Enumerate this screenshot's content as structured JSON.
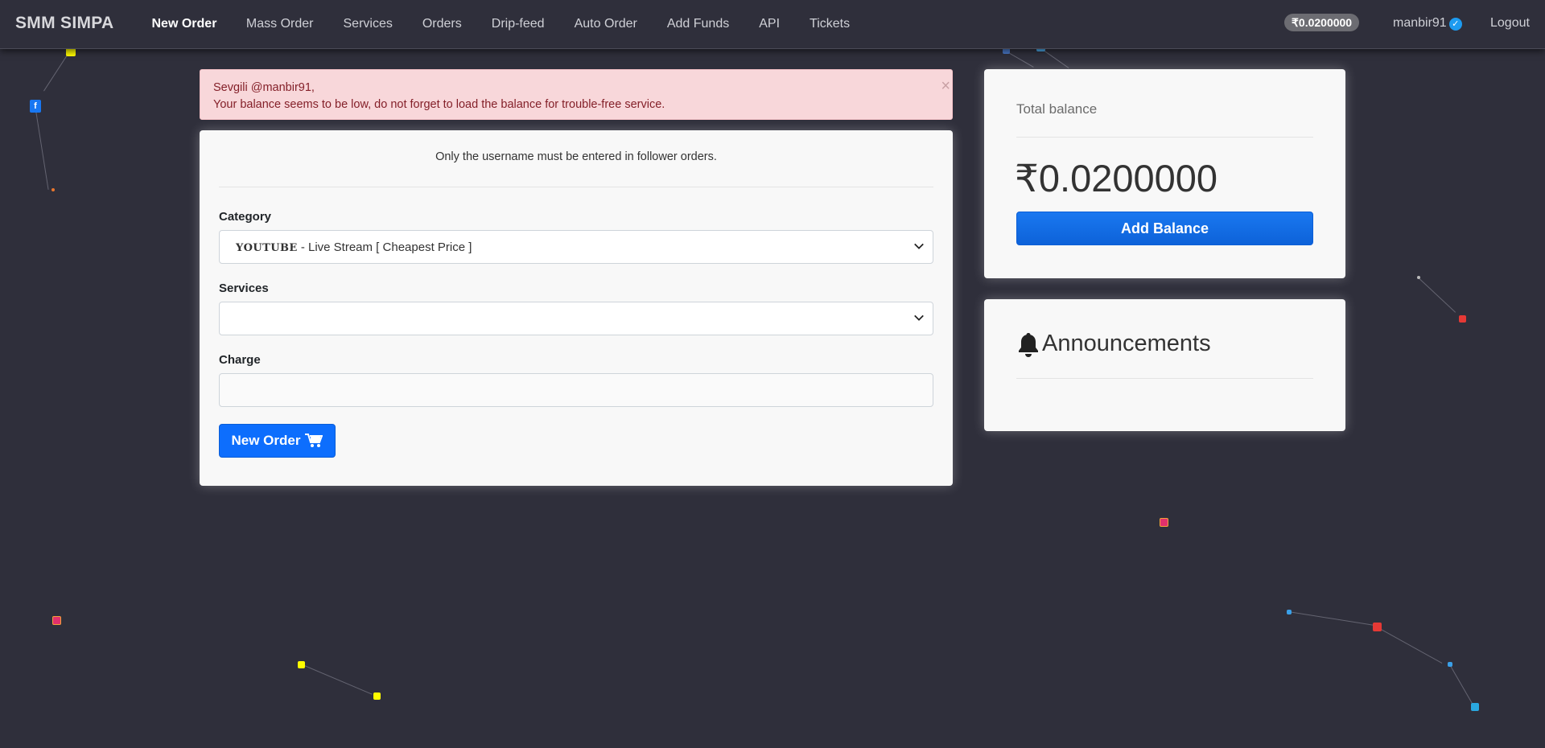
{
  "nav": {
    "brand": "SMM SIMPA",
    "links": [
      {
        "label": "New Order"
      },
      {
        "label": "Mass Order"
      },
      {
        "label": "Services"
      },
      {
        "label": "Orders"
      },
      {
        "label": "Drip-feed"
      },
      {
        "label": "Auto Order"
      },
      {
        "label": "Add Funds"
      },
      {
        "label": "API"
      },
      {
        "label": "Tickets"
      }
    ],
    "balance": "₹0.0200000",
    "username": "manbir91",
    "verified_icon": "check-icon",
    "logout": "Logout"
  },
  "alert": {
    "greeting": "Sevgili @manbir91,",
    "message": "Your balance seems to be low, do not forget to load the balance for trouble-free service.",
    "close": "×"
  },
  "order_form": {
    "notice": "Only the username must be entered in follower orders.",
    "category_label": "Category",
    "category_platform": "YOUTUBE",
    "category_value": " - Live Stream [ Cheapest Price ]",
    "services_label": "Services",
    "services_value": "",
    "charge_label": "Charge",
    "charge_value": "",
    "submit_label": "New Order"
  },
  "balance_card": {
    "label": "Total balance",
    "amount": "₹0.0200000",
    "button": "Add Balance"
  },
  "announcements": {
    "title": "Announcements"
  },
  "colors": {
    "background": "#2f2f3b",
    "primary": "#0d6efd",
    "alert_bg": "#f8d7da",
    "alert_text": "#842029"
  }
}
